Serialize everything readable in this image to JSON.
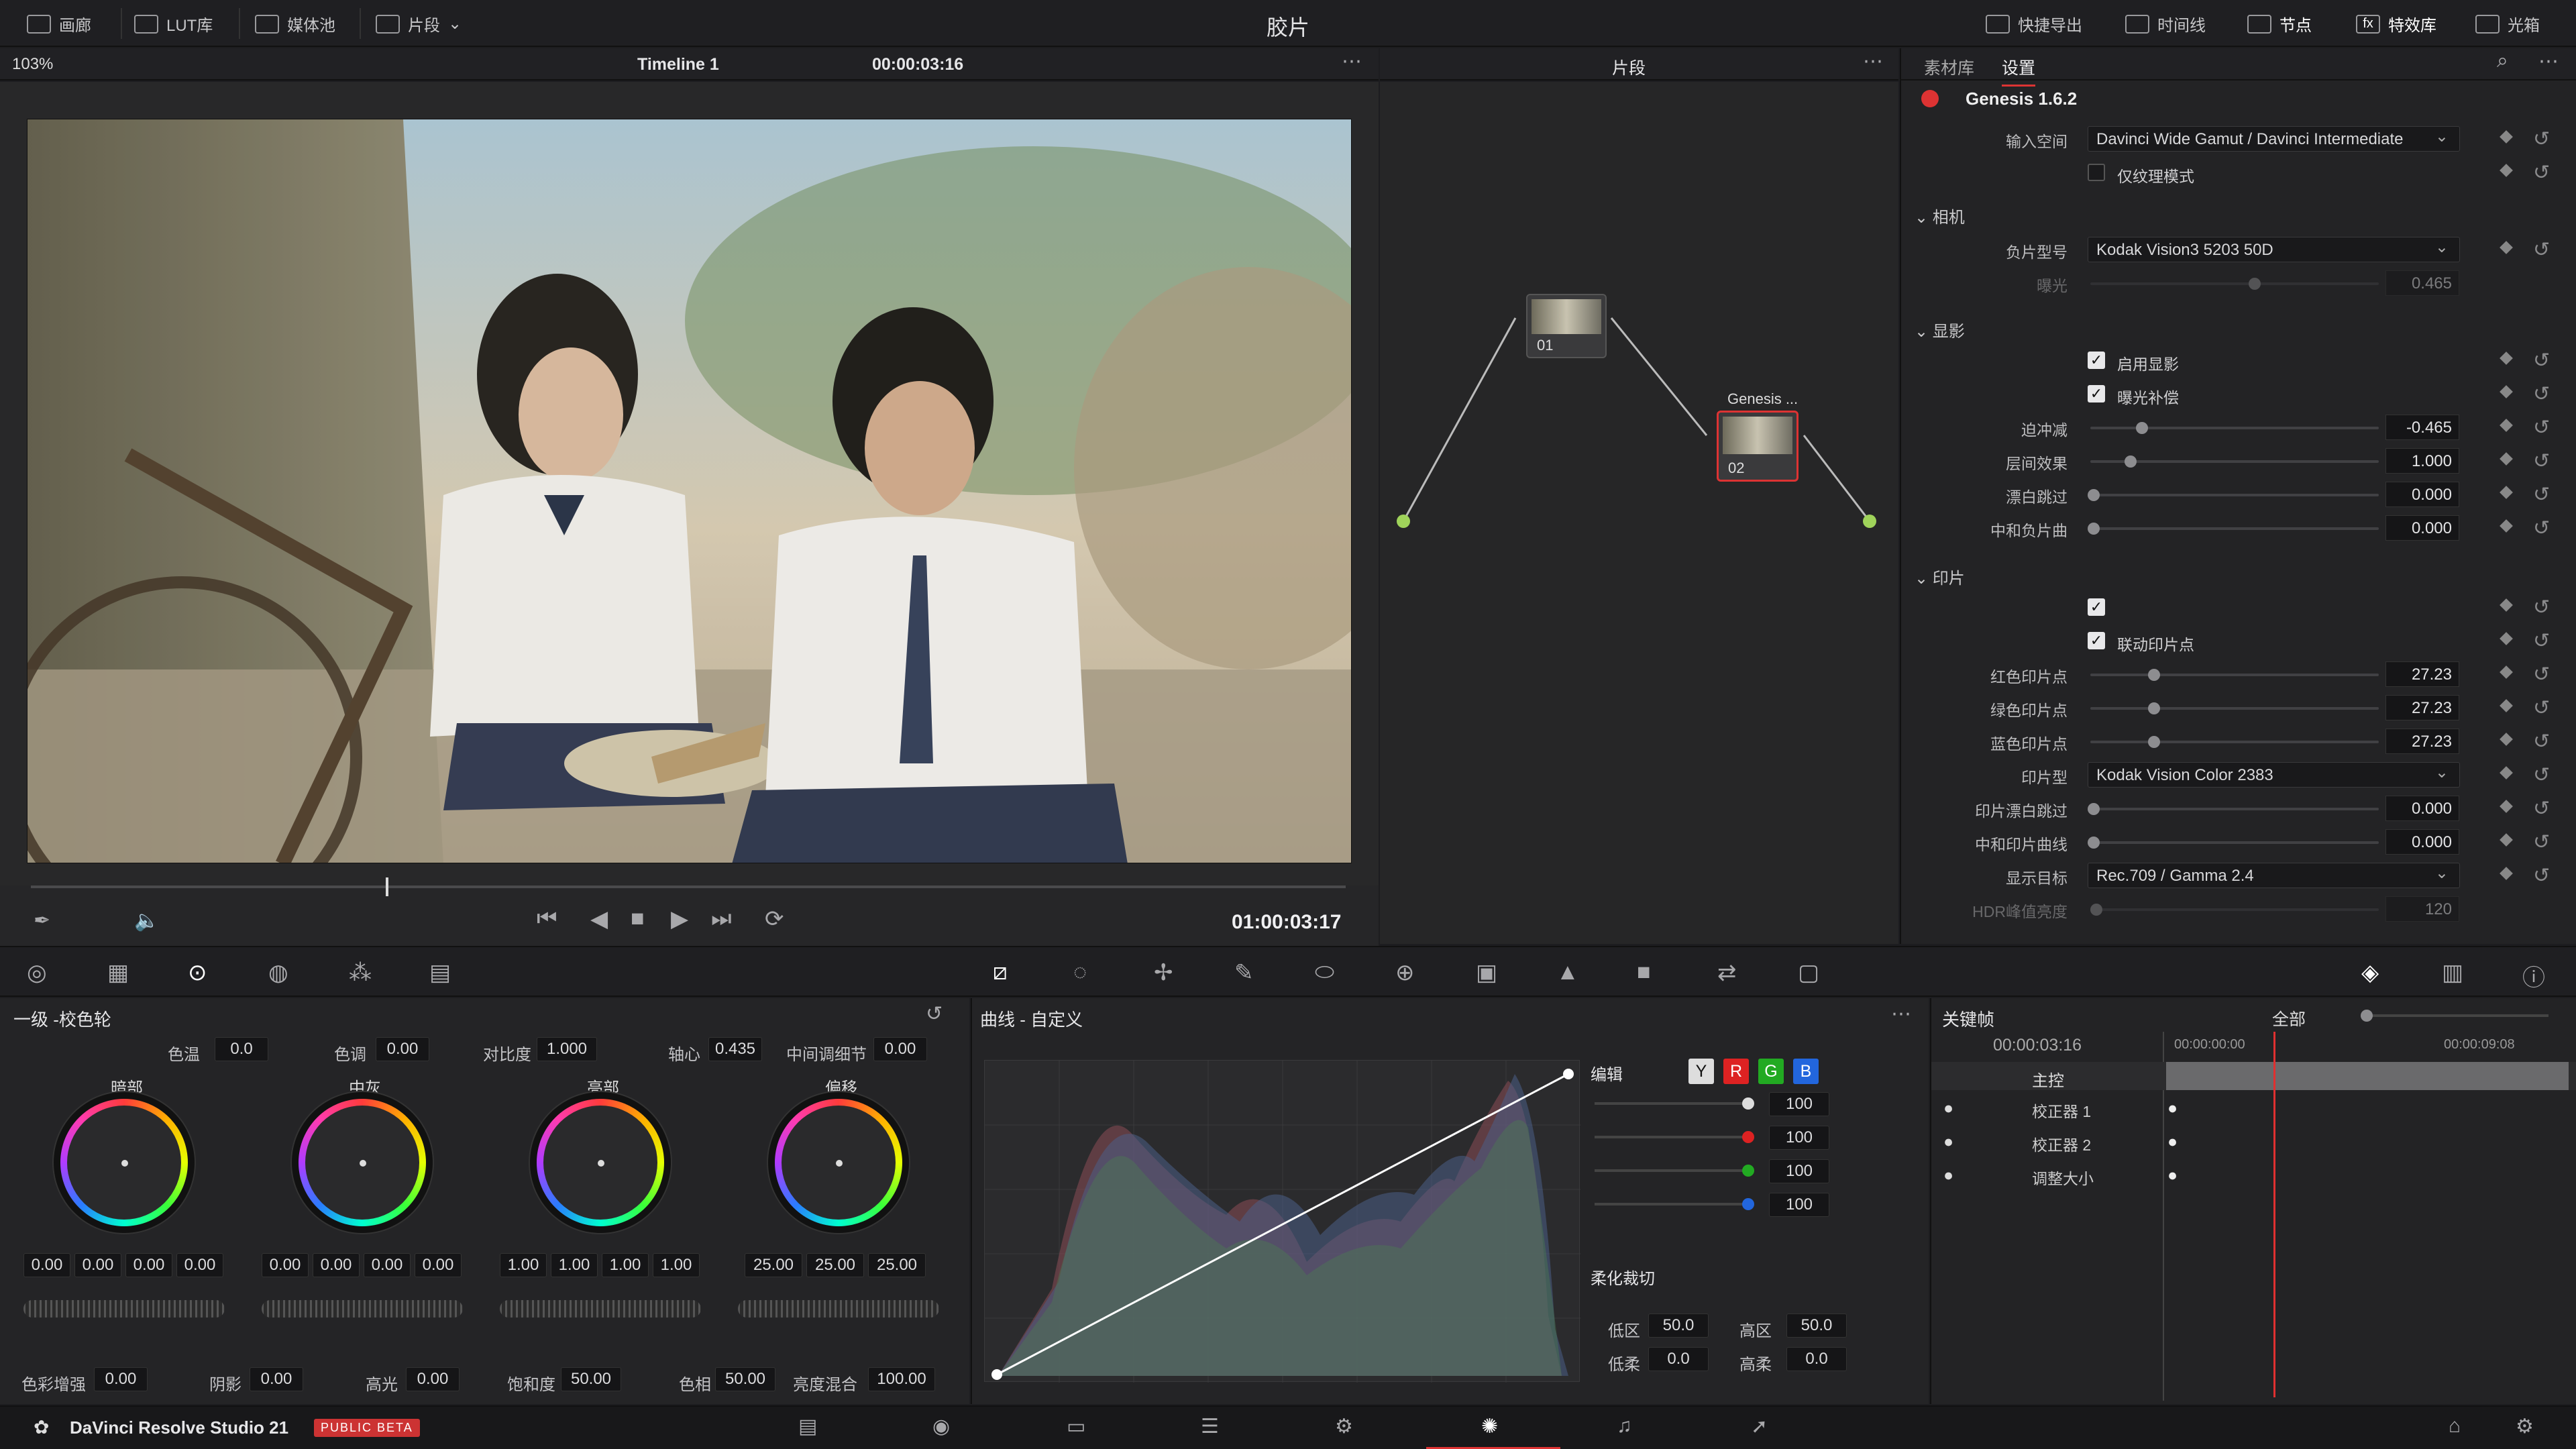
{
  "app": {
    "title": "胶片",
    "product": "DaVinci Resolve Studio 21",
    "badge": "PUBLIC BETA"
  },
  "topbar": {
    "left": [
      "画廊",
      "LUT库",
      "媒体池",
      "片段"
    ],
    "right": [
      "快捷导出",
      "时间线",
      "节点",
      "特效库",
      "光箱"
    ]
  },
  "viewer": {
    "zoom": "103%",
    "timeline_name": "Timeline 1",
    "timecode_top": "00:00:03:16",
    "timecode": "01:00:03:17",
    "playhead_fraction": 0.27
  },
  "nodes": {
    "mode": "片段",
    "node1": "01",
    "node2": "02",
    "node2_title": "Genesis ..."
  },
  "right_panel": {
    "tabs": [
      "素材库",
      "设置"
    ],
    "plugin": "Genesis 1.6.2",
    "input_space_label": "输入空间",
    "input_space": "Davinci Wide Gamut / Davinci Intermediate",
    "texture_label": "仅纹理模式",
    "camera_section": "相机",
    "film_label": "负片型号",
    "film": "Kodak Vision3 5203 50D",
    "exposure_label": "曝光",
    "exposure": "0.465",
    "develop_section": "显影",
    "enable_develop": "启用显影",
    "exposure_comp": "曝光补偿",
    "push_label": "迫冲减",
    "push": "-0.465",
    "push_pos": 0.18,
    "interlayer_label": "层间效果",
    "interlayer": "1.000",
    "interlayer_pos": 0.14,
    "bleach_label": "漂白跳过",
    "bleach": "0.000",
    "neutral_label": "中和负片曲",
    "neutral": "0.000",
    "print_section": "印片",
    "link_print": "联动印片点",
    "red_label": "红色印片点",
    "red": "27.23",
    "green_label": "绿色印片点",
    "green": "27.23",
    "blue_label": "蓝色印片点",
    "blue": "27.23",
    "print_slider_pos": 0.22,
    "print_type_label": "印片型",
    "print_type": "Kodak Vision Color 2383",
    "print_bleach_label": "印片漂白跳过",
    "print_bleach": "0.000",
    "print_neutral_label": "中和印片曲线",
    "print_neutral": "0.000",
    "display_label": "显示目标",
    "display": "Rec.709 / Gamma 2.4",
    "hdr_label": "HDR峰值亮度",
    "hdr": "120"
  },
  "primaries": {
    "title": "一级 -校色轮",
    "temp_label": "色温",
    "temp": "0.0",
    "tint_label": "色调",
    "tint": "0.00",
    "contrast_label": "对比度",
    "contrast": "1.000",
    "pivot_label": "轴心",
    "pivot": "0.435",
    "md_label": "中间调细节",
    "md": "0.00",
    "wheels": [
      {
        "name": "暗部",
        "vals": [
          "0.00",
          "0.00",
          "0.00",
          "0.00"
        ]
      },
      {
        "name": "中灰",
        "vals": [
          "0.00",
          "0.00",
          "0.00",
          "0.00"
        ]
      },
      {
        "name": "亮部",
        "vals": [
          "1.00",
          "1.00",
          "1.00",
          "1.00"
        ]
      },
      {
        "name": "偏移",
        "vals": [
          "25.00",
          "25.00",
          "25.00"
        ]
      }
    ],
    "boost_label": "色彩增强",
    "boost": "0.00",
    "shadow_label": "阴影",
    "shadow": "0.00",
    "hl_label": "高光",
    "hl": "0.00",
    "sat_label": "饱和度",
    "sat": "50.00",
    "hue_label": "色相",
    "hue": "50.00",
    "lum_label": "亮度混合",
    "lum": "100.00"
  },
  "curves": {
    "title": "曲线 - 自定义",
    "edit_label": "编辑",
    "channels": [
      "Y",
      "R",
      "G",
      "B"
    ],
    "intensity": [
      "100",
      "100",
      "100",
      "100"
    ],
    "soft_clip_label": "柔化裁切",
    "low_label": "低区",
    "low": "50.0",
    "high_label": "高区",
    "high": "50.0",
    "ls_label": "低柔",
    "ls": "0.0",
    "hs_label": "高柔",
    "hs": "0.0"
  },
  "keyframes": {
    "title": "关键帧",
    "filter": "全部",
    "time": "00:00:03:16",
    "t0": "00:00:00:00",
    "t1": "00:00:09:08",
    "master": "主控",
    "rows": [
      "校正器 1",
      "校正器 2",
      "调整大小"
    ]
  },
  "colors": {
    "accent": "#d33",
    "playhead": "#e03030"
  }
}
